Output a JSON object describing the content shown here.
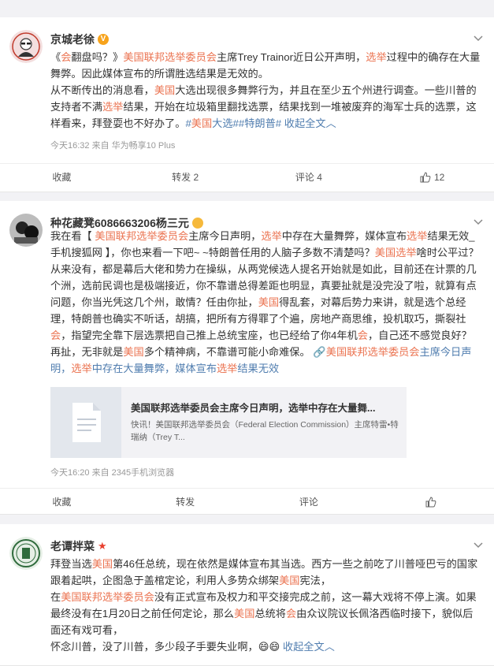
{
  "posts": [
    {
      "author": "京城老徐",
      "badge": "V",
      "segments": [
        {
          "t": "《",
          "c": ""
        },
        {
          "t": "会",
          "c": "hl"
        },
        {
          "t": "翻盘吗？》",
          "c": ""
        },
        {
          "t": "美国联邦选举委员会",
          "c": "hl"
        },
        {
          "t": "主席Trey Trainor近日公开声明，",
          "c": ""
        },
        {
          "t": "选举",
          "c": "hl"
        },
        {
          "t": "过程中的确存在大量舞弊。因此媒体宣布的所谓胜选结果是无效的。",
          "c": ""
        },
        {
          "t": "\n从不断传出的消息看，",
          "c": ""
        },
        {
          "t": "美国",
          "c": "hl"
        },
        {
          "t": "大选出现很多舞弊行为，并且在至少五个州进行调查。一些川普的支持者不满",
          "c": ""
        },
        {
          "t": "选举",
          "c": "hl"
        },
        {
          "t": "结果，开始在垃圾箱里翻找选票，结果找到一堆被废弃的海军士兵的选票，这样看来，拜登耍也不好办了。",
          "c": ""
        },
        {
          "t": "#",
          "c": "link"
        },
        {
          "t": "美国",
          "c": "hl"
        },
        {
          "t": "大选##特朗普# ",
          "c": "link"
        },
        {
          "t": "收起全文",
          "c": "link"
        },
        {
          "t": "︿",
          "c": "link"
        }
      ],
      "meta": "今天16:32  来自 华为畅享10 Plus",
      "actions": {
        "collect": "收藏",
        "repost": "转发 2",
        "comment": "评论 4",
        "like": "12"
      }
    },
    {
      "author": "种花藏凳6086663206杨三元",
      "segments": [
        {
          "t": "我在看【 ",
          "c": ""
        },
        {
          "t": "美国联邦选举委员会",
          "c": "hl"
        },
        {
          "t": "主席今日声明，",
          "c": ""
        },
        {
          "t": "选举",
          "c": "hl"
        },
        {
          "t": "中存在大量舞弊，媒体宣布",
          "c": ""
        },
        {
          "t": "选举",
          "c": "hl"
        },
        {
          "t": "结果无效_手机搜狐网 】，你也来看一下吧~ ~特朗普任用的人脑子多数不清楚吗？",
          "c": ""
        },
        {
          "t": "美国选举",
          "c": "hl"
        },
        {
          "t": "啥时公平过？从来没有，都是幕后大佬和势力在操纵，从两党候选人提名开始就是如此，目前还在计票的几个洲，选前民调也是极端接近，你不靠谱总得差距也明显，真要扯就是没完没了啦，就算有点问题，你当光凭这几个州，敢情？任由你扯，",
          "c": ""
        },
        {
          "t": "美国",
          "c": "hl"
        },
        {
          "t": "得乱套，对幕后势力来讲，就是选个总经理，特朗普也确实不听话，胡搞，把所有方得罪了个遍，房地产商思维，投机取巧，撕裂社",
          "c": ""
        },
        {
          "t": "会",
          "c": "hl"
        },
        {
          "t": "，指望完全靠下层选票把自己推上总统宝座，也已经给了你4年机",
          "c": ""
        },
        {
          "t": "会",
          "c": "hl"
        },
        {
          "t": "，自己还不感觉良好？再扯，无非就是",
          "c": ""
        },
        {
          "t": "美国",
          "c": "hl"
        },
        {
          "t": "多个精神病，不靠谱可能小命难保。 ",
          "c": ""
        },
        {
          "t": "🔗",
          "c": "link"
        },
        {
          "t": "美国联邦选举委员会",
          "c": "hl"
        },
        {
          "t": "主席今日声明，",
          "c": "link"
        },
        {
          "t": "选举",
          "c": "hl"
        },
        {
          "t": "中存在大量舞弊，媒体宣布",
          "c": "link"
        },
        {
          "t": "选举",
          "c": "hl"
        },
        {
          "t": "结果无效",
          "c": "link"
        }
      ],
      "linkcard": {
        "title": "美国联邦选举委员会主席今日声明，选举中存在大量舞...",
        "desc": "快讯！美国联邦选举委员会（Federal Election Commission）主席特雷•特瑞纳（Trey T..."
      },
      "meta": "今天16:20  来自 2345手机浏览器",
      "actions": {
        "collect": "收藏",
        "repost": "转发",
        "comment": "评论",
        "like": ""
      }
    },
    {
      "author": "老谭拌菜",
      "segments": [
        {
          "t": "拜登当选",
          "c": ""
        },
        {
          "t": "美国",
          "c": "hl"
        },
        {
          "t": "第46任总统，现在依然是媒体宣布其当选。西方一些之前吃了川普哑巴亏的国家跟着起哄，企图急于盖棺定论，利用人多势众绑架",
          "c": ""
        },
        {
          "t": "美国",
          "c": "hl"
        },
        {
          "t": "宪法，\n在",
          "c": ""
        },
        {
          "t": "美国联邦选举委员会",
          "c": "hl"
        },
        {
          "t": "没有正式宣布及权力和平交接完成之前，这一幕大戏将不停上演。如果最终没有在1月20日之前任何定论，那么",
          "c": ""
        },
        {
          "t": "美国",
          "c": "hl"
        },
        {
          "t": "总统将",
          "c": ""
        },
        {
          "t": "会",
          "c": "hl"
        },
        {
          "t": "由众议院议长佩洛西临时接下，貌似后面还有戏可看，\n怀念川普，没了川普，多少段子手要失业啊，",
          "c": ""
        },
        {
          "t": "😄😄",
          "c": ""
        },
        {
          "t": " 收起全文",
          "c": "link"
        },
        {
          "t": "︿",
          "c": "link"
        }
      ]
    }
  ]
}
